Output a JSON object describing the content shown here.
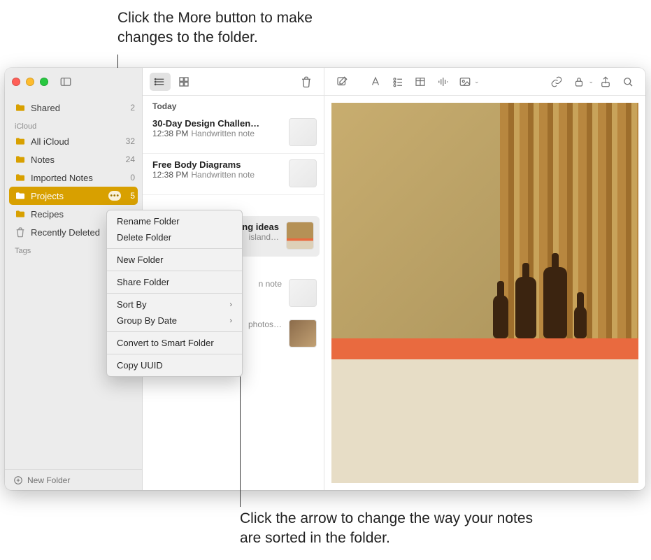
{
  "callouts": {
    "top": "Click the More button to make changes to the folder.",
    "bottom": "Click the arrow to change the way your notes are sorted in the folder."
  },
  "sidebar": {
    "shared": {
      "label": "Shared",
      "count": "2"
    },
    "groups": {
      "icloud_header": "iCloud",
      "tags_header": "Tags"
    },
    "items": [
      {
        "label": "All iCloud",
        "count": "32"
      },
      {
        "label": "Notes",
        "count": "24"
      },
      {
        "label": "Imported Notes",
        "count": "0"
      },
      {
        "label": "Projects",
        "count": "5"
      },
      {
        "label": "Recipes",
        "count": ""
      },
      {
        "label": "Recently Deleted",
        "count": ""
      }
    ],
    "footer": "New Folder"
  },
  "notelist": {
    "section": "Today",
    "notes": [
      {
        "title": "30-Day Design Challen…",
        "time": "12:38 PM",
        "preview": "Handwritten note"
      },
      {
        "title": "Free Body Diagrams",
        "time": "12:38 PM",
        "preview": "Handwritten note"
      },
      {
        "title": "ng ideas",
        "time": "",
        "preview": "island…"
      },
      {
        "title": "",
        "time": "",
        "preview": "n note"
      },
      {
        "title": "",
        "time": "",
        "preview": "photos…"
      }
    ]
  },
  "context_menu": {
    "items": [
      "Rename Folder",
      "Delete Folder",
      "New Folder",
      "Share Folder",
      "Sort By",
      "Group By Date",
      "Convert to Smart Folder",
      "Copy UUID"
    ]
  },
  "icons": {
    "sidebar_toggle": "sidebar-toggle-icon",
    "trash": "trash-icon",
    "compose": "compose-icon",
    "format": "format-icon",
    "checklist": "checklist-icon",
    "table": "table-icon",
    "audio": "audio-icon",
    "media": "media-icon",
    "link": "link-icon",
    "lock": "lock-icon",
    "share": "share-icon",
    "search": "search-icon",
    "list_view": "list-view-icon",
    "grid_view": "grid-view-icon"
  }
}
